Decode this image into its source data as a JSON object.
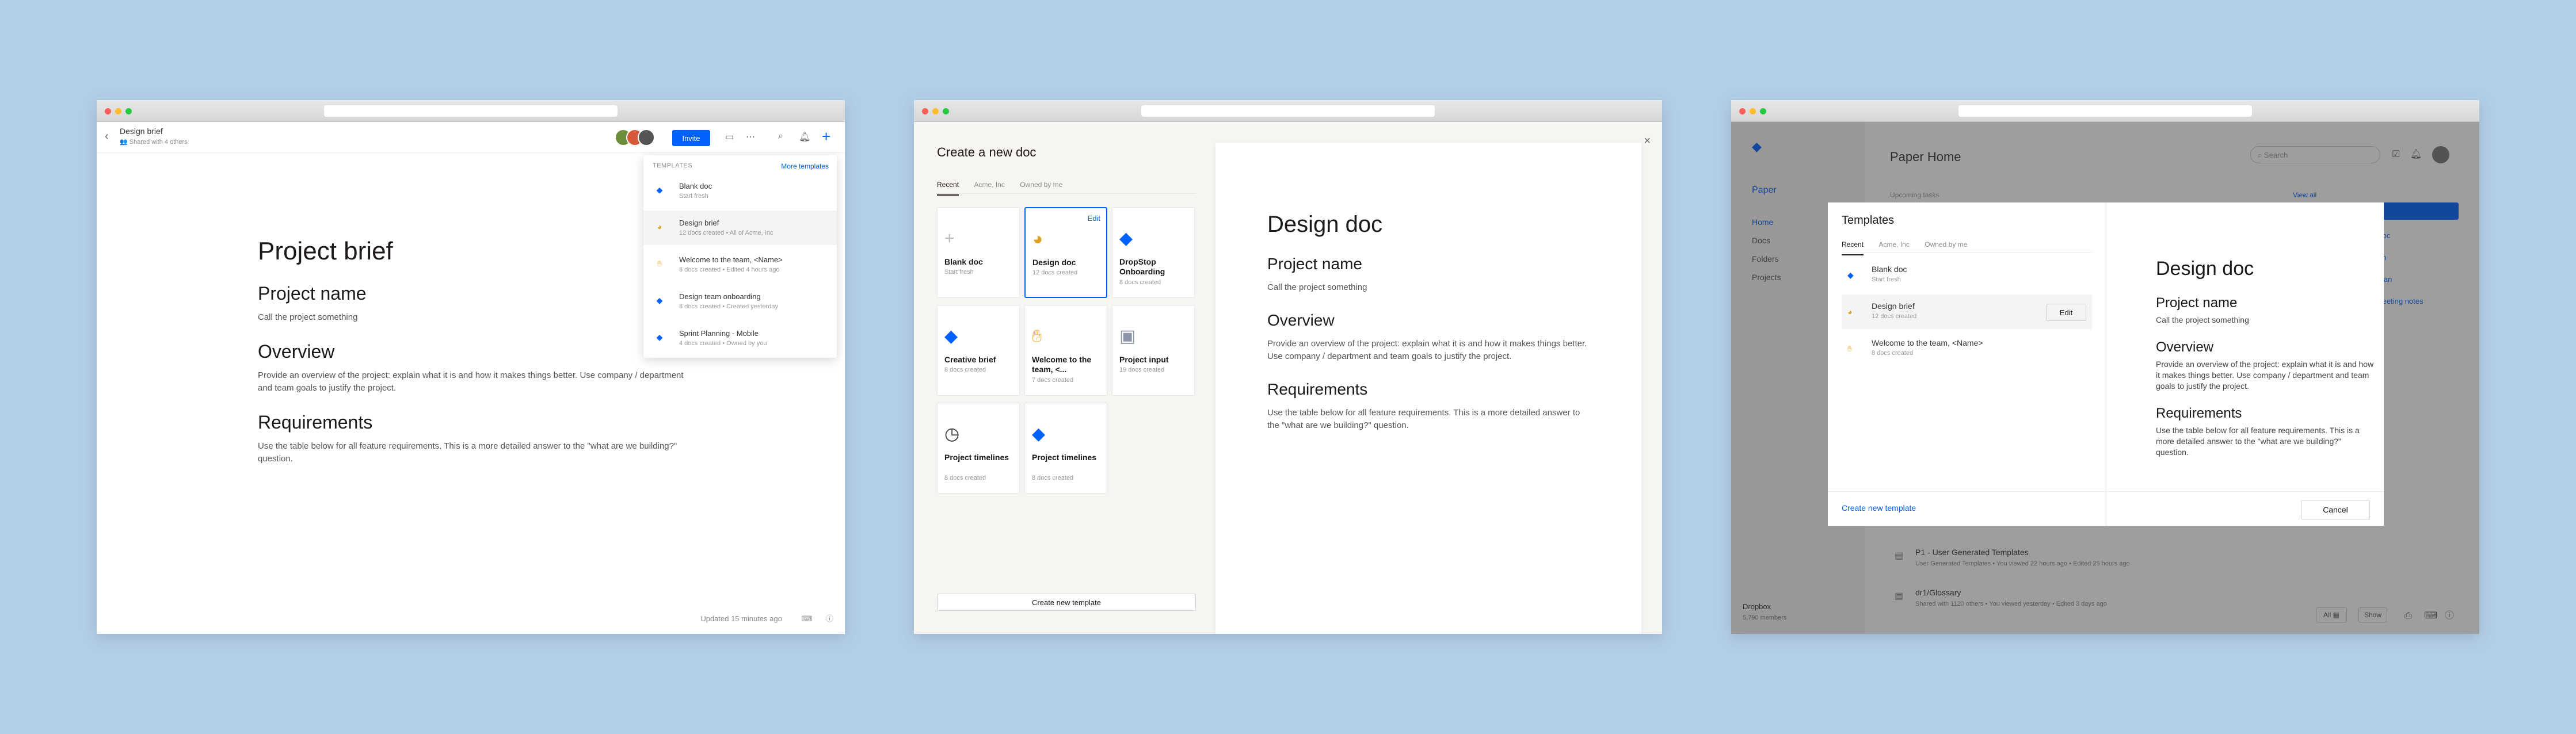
{
  "colors": {
    "accent": "#0061fe",
    "background": "#b3cfe6"
  },
  "win1": {
    "doc_title": "Design brief",
    "shared": "Shared with 4 others",
    "invite_label": "Invite",
    "templates_label": "TEMPLATES",
    "more_templates": "More templates",
    "templates": [
      {
        "title": "Blank doc",
        "sub": "Start fresh",
        "icon": "blue-diamond-icon"
      },
      {
        "title": "Design brief",
        "sub": "12 docs created • All of Acme, Inc",
        "icon": "palette-icon"
      },
      {
        "title": "Welcome to the team, <Name>",
        "sub": "8 docs created • Edited 4 hours ago",
        "icon": "wave-hand-icon"
      },
      {
        "title": "Design team onboarding",
        "sub": "8 docs created • Created yesterday",
        "icon": "blue-diamond-icon"
      },
      {
        "title": "Sprint Planning - Mobile",
        "sub": "4 docs created • Owned by you",
        "icon": "blue-diamond-icon"
      }
    ],
    "doc": {
      "title": "Project brief",
      "h_name": "Project name",
      "p_name": "Call the project something",
      "h_overview": "Overview",
      "p_overview": "Provide an overview of the project: explain what it is and how it makes things better. Use company / department and team goals to justify the project.",
      "h_req": "Requirements",
      "p_req": "Use the table below for all feature requirements. This is a more detailed answer to the \"what are we building?\" question."
    },
    "updated": "Updated 15 minutes ago"
  },
  "win2": {
    "title": "Create a new doc",
    "tabs": [
      "Recent",
      "Acme, Inc",
      "Owned by me"
    ],
    "edit": "Edit",
    "cards": [
      {
        "title": "Blank doc",
        "sub": "Start fresh"
      },
      {
        "title": "Design doc",
        "sub": "12 docs created"
      },
      {
        "title": "DropStop Onboarding",
        "sub": "8 docs created"
      },
      {
        "title": "Creative brief",
        "sub": "8 docs created"
      },
      {
        "title": "Welcome to the team, <...",
        "sub": "7 docs created"
      },
      {
        "title": "Project input",
        "sub": "19 docs created"
      },
      {
        "title": "Project timelines",
        "sub": "8 docs created"
      },
      {
        "title": "Project timelines",
        "sub": "8 docs created"
      }
    ],
    "create_template": "Create new template",
    "preview": {
      "title": "Design doc",
      "h_name": "Project name",
      "p_name": "Call the project something",
      "h_overview": "Overview",
      "p_overview": "Provide an overview of the project: explain what it is and how it makes things better. Use company / department and team goals to justify the project.",
      "h_req": "Requirements",
      "p_req": "Use the table below for all feature requirements. This is a more detailed answer to the \"what are we building?\" question."
    }
  },
  "win3": {
    "brand": "Paper",
    "nav": [
      "Home",
      "Docs",
      "Folders",
      "Projects"
    ],
    "home_title": "Paper Home",
    "search_placeholder": "Search",
    "upcoming": "Upcoming tasks",
    "view_all": "View all",
    "side_links": [
      "te doc",
      "ation",
      "ct plan",
      "n meeting notes"
    ],
    "footer_team": "Dropbox",
    "footer_members": "5,790 members",
    "rows": [
      {
        "title": "P1 - User Generated Templates",
        "sub": "User Generated Templates • You viewed 22 hours ago • Edited 25 hours ago"
      },
      {
        "title": "dr1/Glossary",
        "sub": "Shared with 1120 others • You viewed yesterday • Edited 3 days ago"
      }
    ],
    "all_label": "All",
    "show_label": "Show",
    "modal": {
      "title": "Templates",
      "tabs": [
        "Recent",
        "Acme, Inc",
        "Owned by me"
      ],
      "items": [
        {
          "title": "Blank doc",
          "sub": "Start fresh"
        },
        {
          "title": "Design brief",
          "sub": "12 docs created"
        },
        {
          "title": "Welcome to the team, <Name>",
          "sub": "8 docs created"
        }
      ],
      "edit": "Edit",
      "create_template": "Create new template",
      "cancel": "Cancel",
      "preview": {
        "title": "Design doc",
        "h_name": "Project name",
        "p_name": "Call the project something",
        "h_overview": "Overview",
        "p_overview": "Provide an overview of the project: explain what it is and how it makes things better. Use company / department and team goals to justify the project.",
        "h_req": "Requirements",
        "p_req": "Use the table below for all feature requirements. This is a more detailed answer to the \"what are we building?\" question."
      }
    }
  }
}
